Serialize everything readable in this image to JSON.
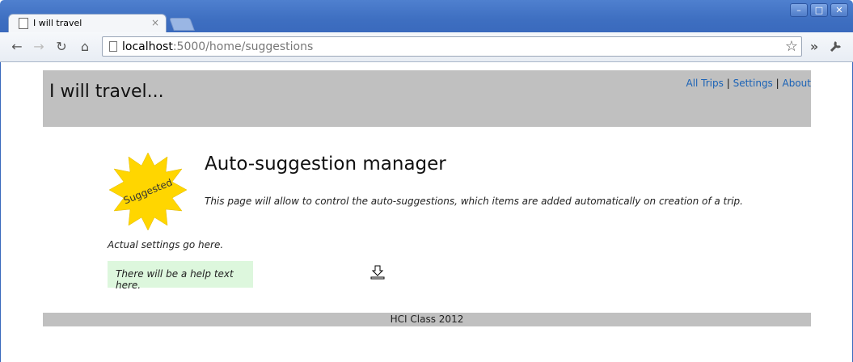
{
  "browser": {
    "tab_title": "I will travel",
    "tab_close": "×",
    "url_host": "localhost",
    "url_path": ":5000/home/suggestions",
    "window_minimize": "–",
    "window_maximize": "□",
    "window_close": "✕"
  },
  "header": {
    "title": "I will travel...",
    "nav": [
      {
        "label": "All Trips"
      },
      {
        "label": "Settings"
      },
      {
        "label": "About"
      }
    ],
    "nav_separator": "|"
  },
  "main": {
    "badge_text": "Suggested",
    "badge_color": "#ffd600",
    "title": "Auto-suggestion manager",
    "description": "This page will allow to control the auto-suggestions, which items are added automatically on creation of a trip.",
    "settings_note": "Actual settings go here.",
    "help_text": "There will be a help text here."
  },
  "footer": {
    "text": "HCI Class 2012"
  },
  "colors": {
    "header_bg": "#c0c0c0",
    "help_bg": "#ddf7dd",
    "link": "#1a62b6"
  }
}
